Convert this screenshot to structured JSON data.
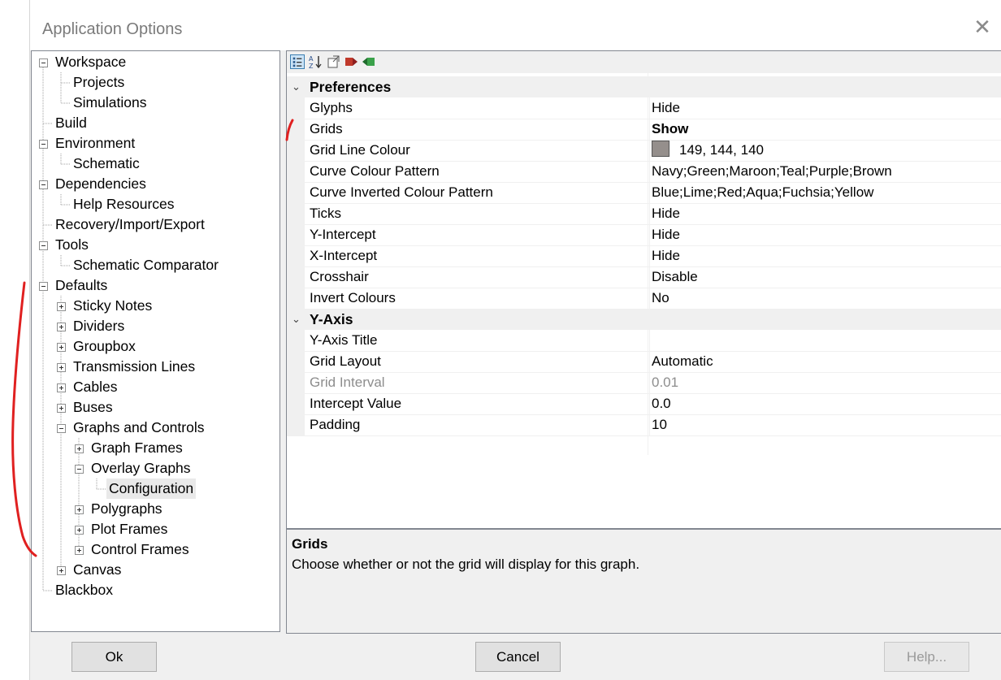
{
  "window": {
    "title": "Application Options"
  },
  "tree": {
    "items": [
      {
        "label": "Workspace",
        "expander": "minus"
      },
      {
        "label": "Projects"
      },
      {
        "label": "Simulations"
      },
      {
        "label": "Build"
      },
      {
        "label": "Environment",
        "expander": "minus"
      },
      {
        "label": "Schematic"
      },
      {
        "label": "Dependencies",
        "expander": "minus"
      },
      {
        "label": "Help Resources"
      },
      {
        "label": "Recovery/Import/Export"
      },
      {
        "label": "Tools",
        "expander": "minus"
      },
      {
        "label": "Schematic Comparator"
      },
      {
        "label": "Defaults",
        "expander": "minus"
      },
      {
        "label": "Sticky Notes",
        "expander": "plus"
      },
      {
        "label": "Dividers",
        "expander": "plus"
      },
      {
        "label": "Groupbox",
        "expander": "plus"
      },
      {
        "label": "Transmission Lines",
        "expander": "plus"
      },
      {
        "label": "Cables",
        "expander": "plus"
      },
      {
        "label": "Buses",
        "expander": "plus"
      },
      {
        "label": "Graphs and Controls",
        "expander": "minus"
      },
      {
        "label": "Graph Frames",
        "expander": "plus"
      },
      {
        "label": "Overlay Graphs",
        "expander": "minus"
      },
      {
        "label": "Configuration",
        "selected": true
      },
      {
        "label": "Polygraphs",
        "expander": "plus"
      },
      {
        "label": "Plot Frames",
        "expander": "plus"
      },
      {
        "label": "Control Frames",
        "expander": "plus"
      },
      {
        "label": "Canvas",
        "expander": "plus"
      },
      {
        "label": "Blackbox"
      }
    ]
  },
  "toolbar": {
    "icons": [
      "categorized-view-icon",
      "alphabetical-sort-icon",
      "property-pages-icon",
      "import-icon",
      "export-icon"
    ]
  },
  "properties": {
    "categories": [
      {
        "title": "Preferences",
        "rows": [
          {
            "name": "Glyphs",
            "value": "Hide"
          },
          {
            "name": "Grids",
            "value": "Show"
          },
          {
            "name": "Grid Line Colour",
            "value": "149, 144, 140",
            "swatch": "#958f8c"
          },
          {
            "name": "Curve Colour Pattern",
            "value": "Navy;Green;Maroon;Teal;Purple;Brown"
          },
          {
            "name": "Curve Inverted Colour Pattern",
            "value": "Blue;Lime;Red;Aqua;Fuchsia;Yellow"
          },
          {
            "name": "Ticks",
            "value": "Hide"
          },
          {
            "name": "Y-Intercept",
            "value": "Hide"
          },
          {
            "name": "X-Intercept",
            "value": "Hide"
          },
          {
            "name": "Crosshair",
            "value": "Disable"
          },
          {
            "name": "Invert Colours",
            "value": "No"
          }
        ]
      },
      {
        "title": "Y-Axis",
        "rows": [
          {
            "name": "Y-Axis Title",
            "value": ""
          },
          {
            "name": "Grid Layout",
            "value": "Automatic"
          },
          {
            "name": "Grid Interval",
            "value": "0.01"
          },
          {
            "name": "Intercept Value",
            "value": "0.0"
          },
          {
            "name": "Padding",
            "value": "10"
          }
        ]
      }
    ]
  },
  "help": {
    "title": "Grids",
    "description": "Choose whether or not the grid will display for this graph."
  },
  "buttons": {
    "ok": "Ok",
    "cancel": "Cancel",
    "help": "Help..."
  },
  "colors": {
    "annotation": "#e02020",
    "swatch_grid_line": "#958f8c"
  }
}
